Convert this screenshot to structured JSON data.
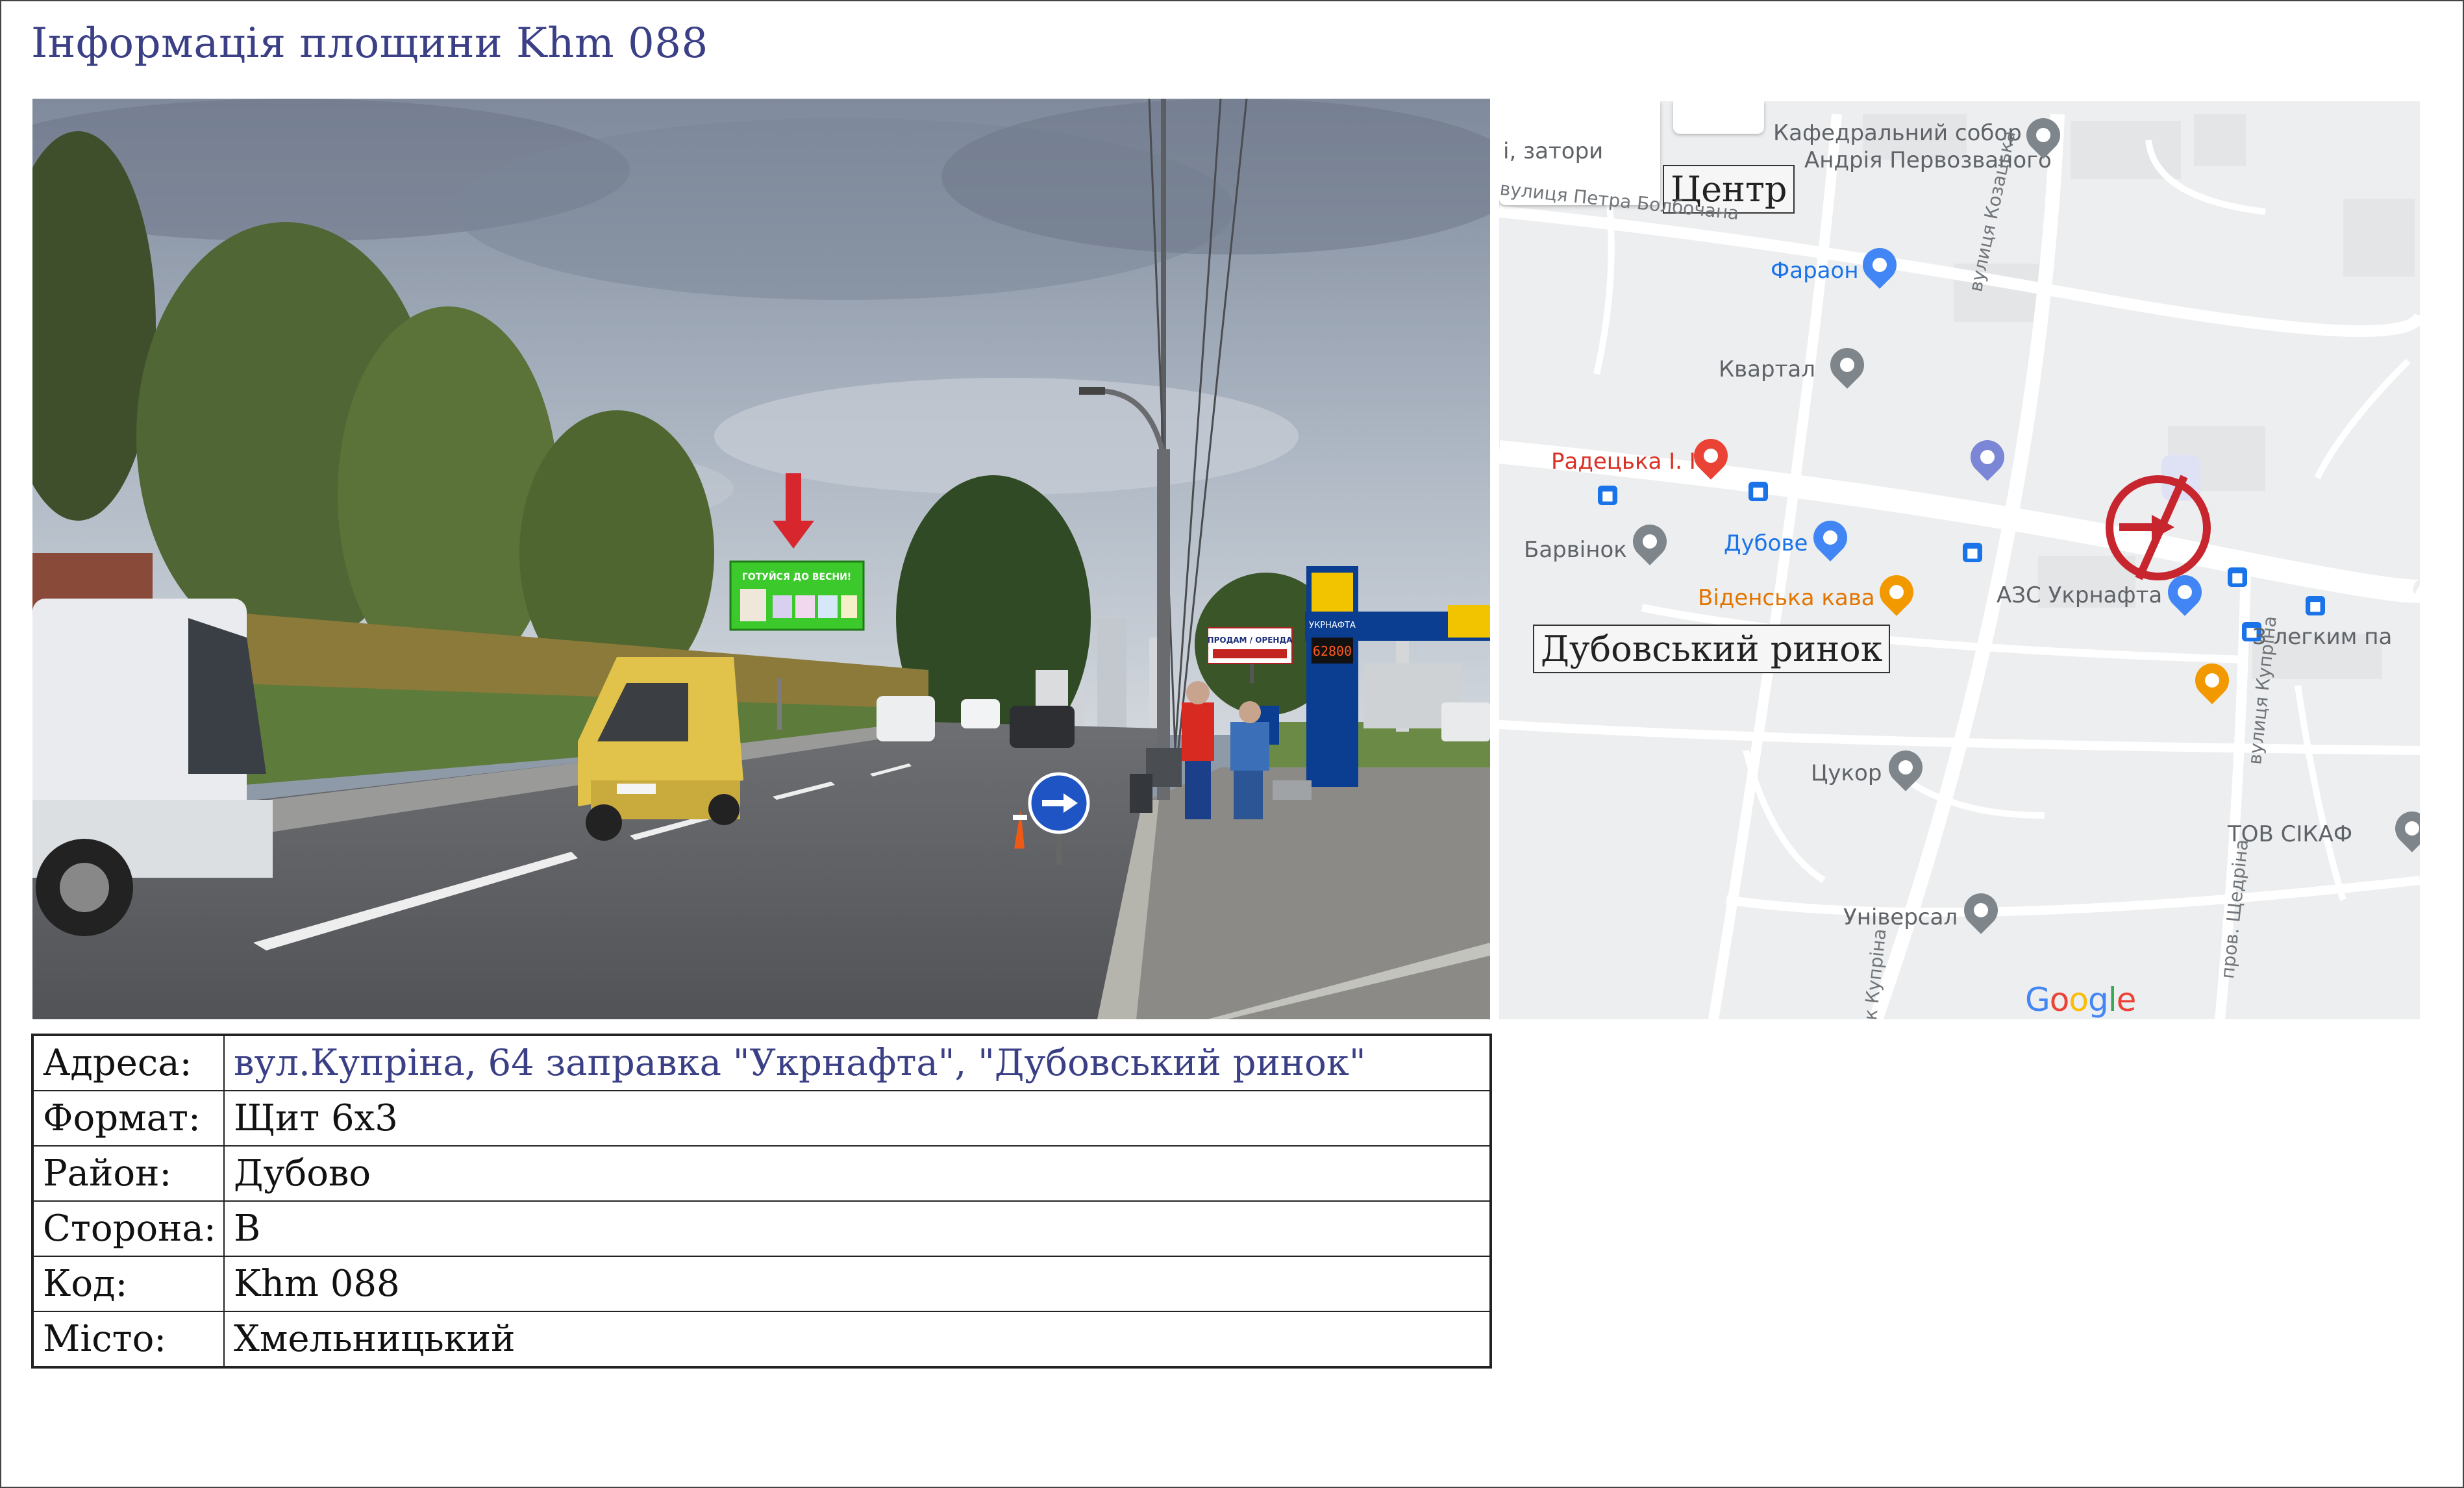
{
  "title": "Інформація площини Khm 088",
  "photo": {
    "billboard_line1": "ГОТУЙСЯ ДО ВЕСНИ!",
    "station_brand": "УКРНАФТА",
    "price": "62800",
    "sale_sign": "ПРОДАМ / ОРЕНДА",
    "accent_arrow": "#d7262e",
    "billboard_color": "#3cc92b"
  },
  "map": {
    "labels": {
      "cathedral_1": "Кафедральний собор",
      "cathedral_2": "Андрія Первозваного",
      "traffic": "і, затори",
      "center": "Центр",
      "street_bolbochana": "вулиця Петра Болбочана",
      "faraon": "Фараон",
      "kvartal": "Квартал",
      "street_kozatska": "вулиця Козацька",
      "radetska": "Радецька І. І",
      "barvinok": "Барвінок",
      "dubove": "Дубове",
      "videnska": "Віденська кава",
      "azs": "АЗС Укрнафта",
      "legkym": "З легким па",
      "dubovskyi_market": "Дубовський ринок",
      "tsukor": "Цукор",
      "street_kuprina": "вулиця Купріна",
      "tov": "ТОВ СІКАФ",
      "universal": "Універсал",
      "street_kuprina_short": "к Купріна",
      "street_shchedrina": "пров. Щедріна",
      "google": "Google"
    },
    "marker_color": "#c8262f"
  },
  "info": {
    "rows": [
      {
        "key": "Адреса:",
        "value": "вул.Купріна, 64 заправка \"Укрнафта\",  \"Дубовський ринок\""
      },
      {
        "key": "Формат:",
        "value": "Щит 6х3"
      },
      {
        "key": "Район:",
        "value": "Дубово"
      },
      {
        "key": "Сторона:",
        "value": "B"
      },
      {
        "key": "Код:",
        "value": "Khm 088"
      },
      {
        "key": "Місто:",
        "value": "Хмельницький"
      }
    ]
  }
}
